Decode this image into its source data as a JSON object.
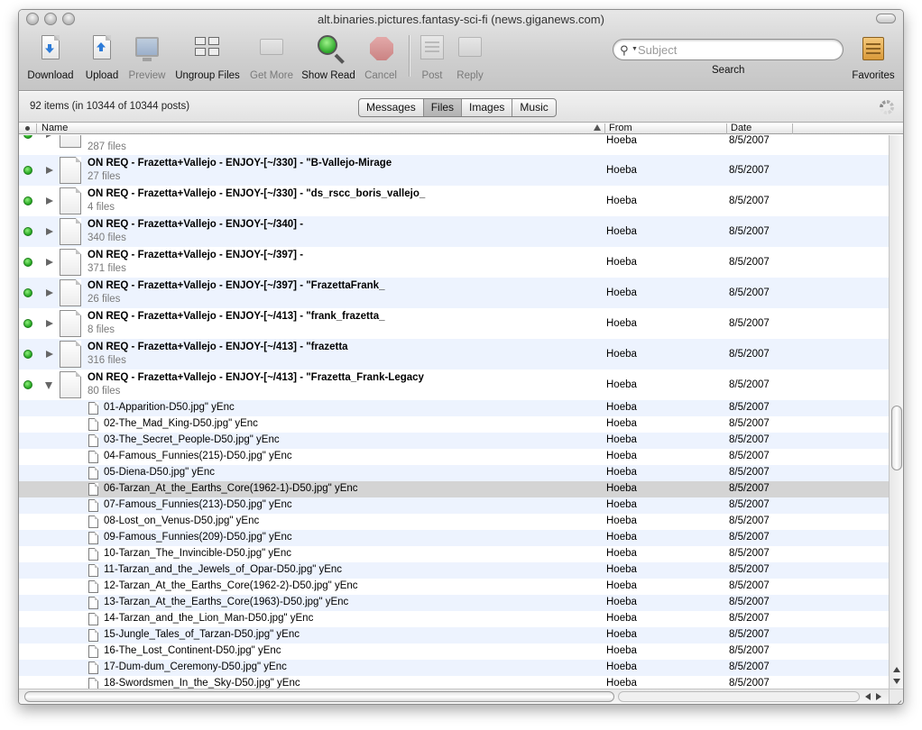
{
  "window": {
    "title": "alt.binaries.pictures.fantasy-sci-fi (news.giganews.com)"
  },
  "toolbar": {
    "download": "Download",
    "upload": "Upload",
    "preview": "Preview",
    "ungroup": "Ungroup Files",
    "get_more": "Get More",
    "show_read": "Show Read",
    "cancel": "Cancel",
    "post": "Post",
    "reply": "Reply",
    "search_placeholder": "Subject",
    "search_label": "Search",
    "favorites": "Favorites"
  },
  "infobar": {
    "count": "92 items (in 10344 of 10344 posts)",
    "tabs": [
      "Messages",
      "Files",
      "Images",
      "Music"
    ],
    "active_tab": "Files"
  },
  "columns": {
    "name": "Name",
    "from": "From",
    "date": "Date"
  },
  "partial_top": {
    "sub": "287 files",
    "from": "Hoeba",
    "date": "8/5/2007"
  },
  "groups": [
    {
      "name": "ON REQ - Frazetta+Vallejo - ENJOY-[~/330] - \"B-Vallejo-Mirage",
      "sub": "27 files",
      "from": "Hoeba",
      "date": "8/5/2007",
      "expanded": false
    },
    {
      "name": "ON REQ - Frazetta+Vallejo - ENJOY-[~/330] - \"ds_rscc_boris_vallejo_",
      "sub": "4 files",
      "from": "Hoeba",
      "date": "8/5/2007",
      "expanded": false
    },
    {
      "name": "ON REQ - Frazetta+Vallejo - ENJOY-[~/340] -",
      "sub": "340 files",
      "from": "Hoeba",
      "date": "8/5/2007",
      "expanded": false
    },
    {
      "name": "ON REQ - Frazetta+Vallejo - ENJOY-[~/397] -",
      "sub": "371 files",
      "from": "Hoeba",
      "date": "8/5/2007",
      "expanded": false
    },
    {
      "name": "ON REQ - Frazetta+Vallejo - ENJOY-[~/397] - \"FrazettaFrank_",
      "sub": "26 files",
      "from": "Hoeba",
      "date": "8/5/2007",
      "expanded": false
    },
    {
      "name": "ON REQ - Frazetta+Vallejo - ENJOY-[~/413] - \"frank_frazetta_",
      "sub": "8 files",
      "from": "Hoeba",
      "date": "8/5/2007",
      "expanded": false
    },
    {
      "name": "ON REQ - Frazetta+Vallejo - ENJOY-[~/413] - \"frazetta",
      "sub": "316 files",
      "from": "Hoeba",
      "date": "8/5/2007",
      "expanded": false
    },
    {
      "name": "ON REQ - Frazetta+Vallejo - ENJOY-[~/413] - \"Frazetta_Frank-Legacy",
      "sub": "80 files",
      "from": "Hoeba",
      "date": "8/5/2007",
      "expanded": true
    }
  ],
  "files": [
    {
      "name": "01-Apparition-D50.jpg\" yEnc",
      "from": "Hoeba",
      "date": "8/5/2007"
    },
    {
      "name": "02-The_Mad_King-D50.jpg\" yEnc",
      "from": "Hoeba",
      "date": "8/5/2007"
    },
    {
      "name": "03-The_Secret_People-D50.jpg\" yEnc",
      "from": "Hoeba",
      "date": "8/5/2007"
    },
    {
      "name": "04-Famous_Funnies(215)-D50.jpg\" yEnc",
      "from": "Hoeba",
      "date": "8/5/2007"
    },
    {
      "name": "05-Diena-D50.jpg\" yEnc",
      "from": "Hoeba",
      "date": "8/5/2007"
    },
    {
      "name": "06-Tarzan_At_the_Earths_Core(1962-1)-D50.jpg\" yEnc",
      "from": "Hoeba",
      "date": "8/5/2007",
      "selected": true
    },
    {
      "name": "07-Famous_Funnies(213)-D50.jpg\" yEnc",
      "from": "Hoeba",
      "date": "8/5/2007"
    },
    {
      "name": "08-Lost_on_Venus-D50.jpg\" yEnc",
      "from": "Hoeba",
      "date": "8/5/2007"
    },
    {
      "name": "09-Famous_Funnies(209)-D50.jpg\" yEnc",
      "from": "Hoeba",
      "date": "8/5/2007"
    },
    {
      "name": "10-Tarzan_The_Invincible-D50.jpg\" yEnc",
      "from": "Hoeba",
      "date": "8/5/2007"
    },
    {
      "name": "11-Tarzan_and_the_Jewels_of_Opar-D50.jpg\" yEnc",
      "from": "Hoeba",
      "date": "8/5/2007"
    },
    {
      "name": "12-Tarzan_At_the_Earths_Core(1962-2)-D50.jpg\" yEnc",
      "from": "Hoeba",
      "date": "8/5/2007"
    },
    {
      "name": "13-Tarzan_At_the_Earths_Core(1963)-D50.jpg\" yEnc",
      "from": "Hoeba",
      "date": "8/5/2007"
    },
    {
      "name": "14-Tarzan_and_the_Lion_Man-D50.jpg\" yEnc",
      "from": "Hoeba",
      "date": "8/5/2007"
    },
    {
      "name": "15-Jungle_Tales_of_Tarzan-D50.jpg\" yEnc",
      "from": "Hoeba",
      "date": "8/5/2007"
    },
    {
      "name": "16-The_Lost_Continent-D50.jpg\" yEnc",
      "from": "Hoeba",
      "date": "8/5/2007"
    },
    {
      "name": "17-Dum-dum_Ceremony-D50.jpg\" yEnc",
      "from": "Hoeba",
      "date": "8/5/2007"
    },
    {
      "name": "18-Swordsmen_In_the_Sky-D50.jpg\" yEnc",
      "from": "Hoeba",
      "date": "8/5/2007"
    }
  ]
}
